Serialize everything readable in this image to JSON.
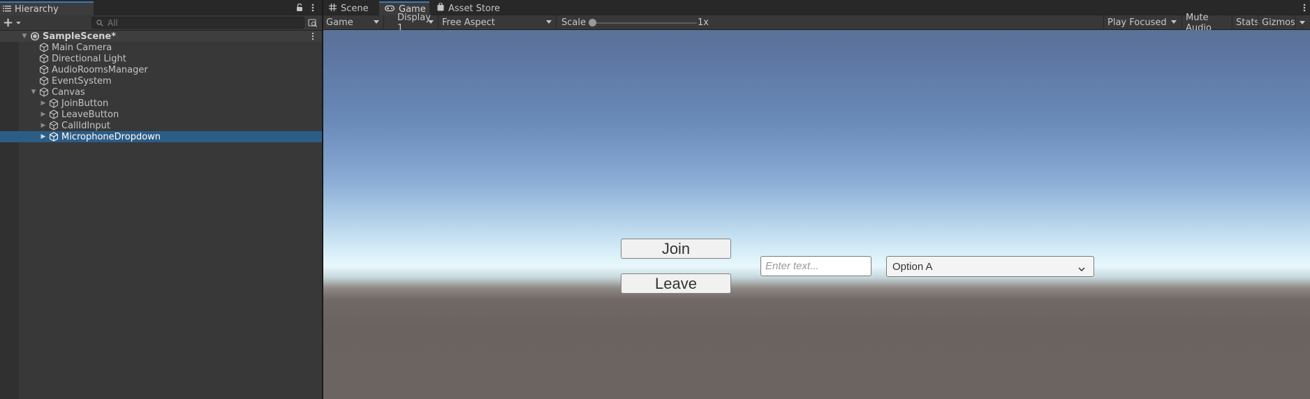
{
  "hierarchy": {
    "tab_label": "Hierarchy",
    "search_placeholder": "All",
    "scene_name": "SampleScene*",
    "items": [
      {
        "label": "Main Camera"
      },
      {
        "label": "Directional Light"
      },
      {
        "label": "AudioRoomsManager"
      },
      {
        "label": "EventSystem"
      },
      {
        "label": "Canvas",
        "expanded": true
      },
      {
        "label": "JoinButton",
        "child_of": "Canvas"
      },
      {
        "label": "LeaveButton",
        "child_of": "Canvas"
      },
      {
        "label": "CallIdInput",
        "child_of": "Canvas"
      },
      {
        "label": "MicrophoneDropdown",
        "child_of": "Canvas",
        "selected": true
      }
    ]
  },
  "game_view": {
    "tabs": [
      {
        "label": "Scene",
        "icon": "grid-icon"
      },
      {
        "label": "Game",
        "icon": "gamepad-icon",
        "active": true
      },
      {
        "label": "Asset Store",
        "icon": "bag-icon"
      }
    ],
    "toolbar": {
      "view_mode": "Game",
      "display": "Display 1",
      "aspect": "Free Aspect",
      "scale_label": "Scale",
      "scale_value": "1x",
      "play_mode": "Play Focused",
      "mute_audio": "Mute Audio",
      "stats": "Stats",
      "gizmos": "Gizmos"
    },
    "scene_ui": {
      "join_label": "Join",
      "leave_label": "Leave",
      "input_placeholder": "Enter text...",
      "dropdown_value": "Option A"
    }
  },
  "colors": {
    "selection": "#2c5d87",
    "active_tab_accent": "#3a79bb",
    "panel_bg": "#383838"
  }
}
